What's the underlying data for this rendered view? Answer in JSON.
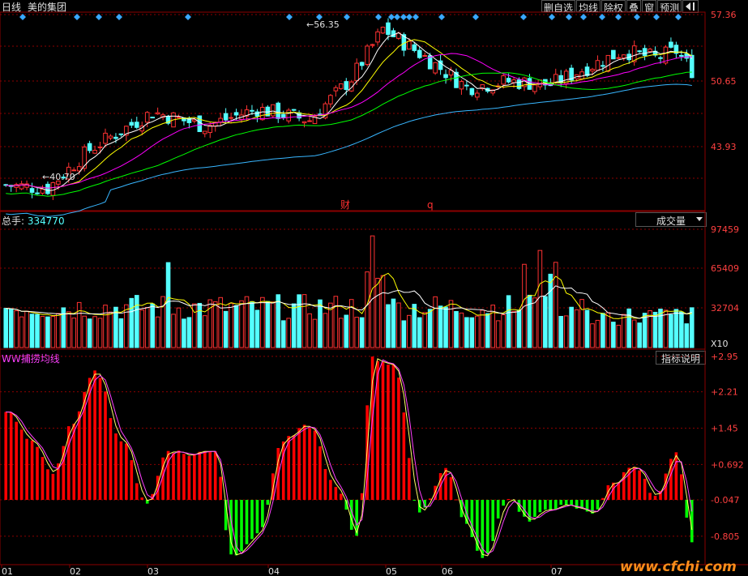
{
  "header": {
    "period_label": "日线",
    "stock_name": "美的集团",
    "buttons": [
      "删自选",
      "均线",
      "除权",
      "叠",
      "窗",
      "预测"
    ],
    "back_icon": "back-arrow-icon"
  },
  "price_panel": {
    "y_ticks": [
      "57.36",
      "50.65",
      "43.93"
    ],
    "high_label": "56.35",
    "low_label": "40.70",
    "markers": [
      "财",
      "q"
    ],
    "diamond_icon": "diamond-icon",
    "colors": {
      "up": "#ff3232",
      "down": "#54ffff",
      "ma5": "#ffffff",
      "ma10": "#ffff00",
      "ma20": "#ff00ff",
      "ma30": "#00ff00",
      "ma60": "#38b6ff",
      "grid": "#8b0000"
    }
  },
  "volume_panel": {
    "label": "总手: ",
    "value": "334770",
    "selector": "成交量",
    "y_ticks": [
      "97459",
      "65409",
      "32704"
    ],
    "unit": "X10"
  },
  "indicator_panel": {
    "label": "WW捕捞均线",
    "help_button": "指标说明",
    "y_ticks": [
      "+2.95",
      "+2.21",
      "+1.45",
      "+0.692",
      "-0.047",
      "-0.805"
    ],
    "colors": {
      "pos": "#ff0000",
      "neg": "#00ff00",
      "line": "#ffff66"
    }
  },
  "x_axis": {
    "months": [
      "01",
      "02",
      "03",
      "04",
      "05",
      "06",
      "07"
    ],
    "watermark": "www.cfchi.com"
  },
  "chart_data": {
    "type": "candlestick",
    "title": "美的集团 日线",
    "price_range": [
      38.5,
      58.0
    ],
    "annotated_high": 56.35,
    "annotated_low": 40.7,
    "volume_range": [
      0,
      97459
    ],
    "indicator_name": "WW捕捞均线",
    "indicator_range": [
      -1.4,
      3.1
    ]
  }
}
